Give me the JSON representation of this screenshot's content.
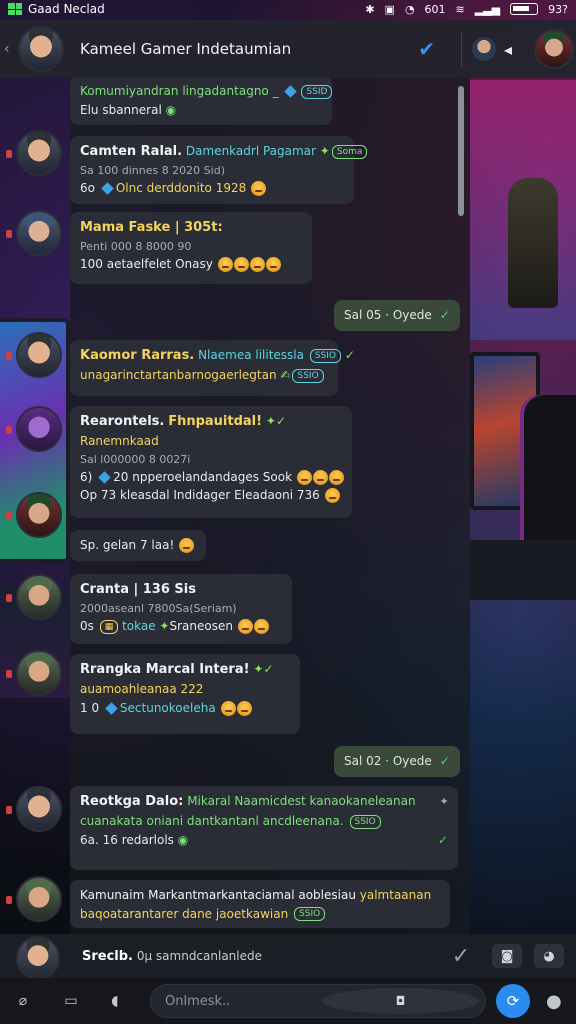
{
  "status": {
    "app": "Gaad Neclad",
    "mid": "601",
    "battery": "93?"
  },
  "header": {
    "title": "Kameel Gamer Indetaumian"
  },
  "messages": [
    {
      "line1": "Komumiyandran lingadantagno _",
      "line2": "Elu sbanneral"
    },
    {
      "name": "Camten Ralal.",
      "name2": "Damenkadrl Pagamar",
      "meta": "Sa 100 dinnes 8 2020 Sid)",
      "body": "6o",
      "body2": "Olnc derddonito 1928"
    },
    {
      "name": "Mama Faske | 305t:",
      "meta": "Penti 000 8 8000 90",
      "body": "100 aetaelfelet Onasy"
    },
    {
      "name": "Kaomor Rarras.",
      "name2": "Nlaemea lilitessla",
      "line2": "unagarinctartanbarnogaerlegtan"
    },
    {
      "name": "Rearontels.",
      "name2": "Fhnpauitdal!",
      "sub": "Ranemnkaad",
      "meta": "Sal l000000 8 0027i",
      "body": "6)",
      "body2": "20 npperoelandandages Sook",
      "body3": "Op",
      "body4": "73 kleasdal Indidager Eleadaoni 736"
    },
    {
      "body": "Sp. gelan 7 laa!"
    },
    {
      "name": "Cranta | 136 Sis",
      "meta": "2000aseanl 7800Sa(Seriam)",
      "body": "0s",
      "body2": "tokae",
      "body3": "Sraneosen"
    },
    {
      "name": "Rrangka Marcal Intera!",
      "meta": "auamoahleanaa 222",
      "body": "1 0",
      "body2": "Sectunokoeleha"
    },
    {
      "name": "Reotkga Dalo:",
      "name2": "Mikaral Naamicdest kanaokaneleanan",
      "line2": "cuanakata oniani dantkantanl ancdleenana.",
      "line3": "6a. 16 redarlols"
    },
    {
      "line1": "Kamunaim Markantmarkantaciamal aoblesiau",
      "line1b": "yalmtaanan",
      "line2": "baqoatarantarer dane jaoetkawian"
    }
  ],
  "outgoing": [
    {
      "text": "Sal 05 · Oyede"
    },
    {
      "text": "Sal 02 · Oyede"
    }
  ],
  "composer": {
    "name": "Sreclb.",
    "preview": "0μ samndcanlanlede",
    "placeholder": "Onlmesk.."
  },
  "pills": {
    "p1": "SSID",
    "p2": "Soma",
    "p3": "SSIO",
    "p4": "SSIO",
    "p5": "SSIO"
  },
  "colors": {
    "accent": "#2a8cf0",
    "name_yellow": "#f4d35e",
    "text_green": "#7ee07a",
    "text_cyan": "#5ed4e0"
  }
}
